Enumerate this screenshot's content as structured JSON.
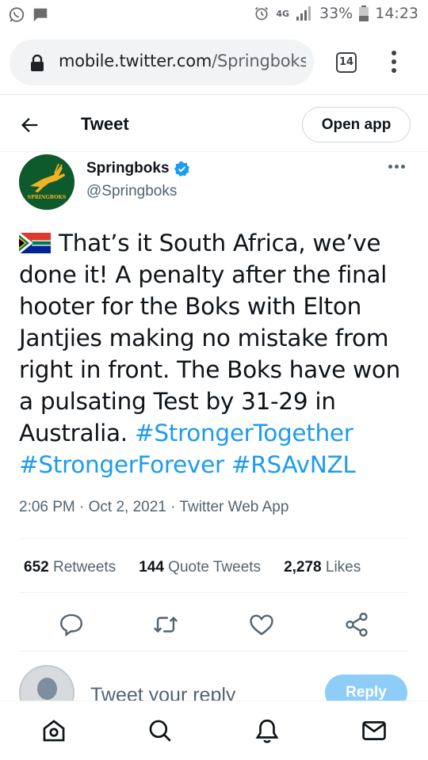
{
  "status_bar": {
    "network": "4G",
    "battery": "33%",
    "time": "14:23"
  },
  "browser": {
    "url_domain": "mobile.twitter.com",
    "url_path": "/Springboks",
    "tab_count": "14"
  },
  "header": {
    "title": "Tweet",
    "open_app": "Open app"
  },
  "tweet": {
    "author_name": "Springboks",
    "handle": "@Springboks",
    "avatar_text": "SPRINGBOKS",
    "text": "That’s it South Africa, we’ve done it! A penalty after the final hooter for the Boks with Elton Jantjies making no mistake from right in front. The Boks have won a pulsating Test by 31-29 in Australia.",
    "hashtags": [
      "#StrongerTogether",
      "#StrongerForever",
      "#RSAvNZL"
    ],
    "timestamp": "2:06 PM · Oct 2, 2021 · Twitter Web App",
    "stats": [
      {
        "count": "652",
        "label": "Retweets"
      },
      {
        "count": "144",
        "label": "Quote Tweets"
      },
      {
        "count": "2,278",
        "label": "Likes"
      }
    ]
  },
  "reply": {
    "placeholder": "Tweet your reply",
    "button": "Reply"
  },
  "icons": {
    "actions": [
      "reply-icon",
      "retweet-icon",
      "like-icon",
      "share-icon"
    ],
    "nav": [
      "home-icon",
      "search-icon",
      "notifications-icon",
      "messages-icon"
    ]
  },
  "colors": {
    "accent": "#1d9bf0",
    "reply_button": "#8ecdf7",
    "text": "#0f1419",
    "secondary": "#536471"
  }
}
